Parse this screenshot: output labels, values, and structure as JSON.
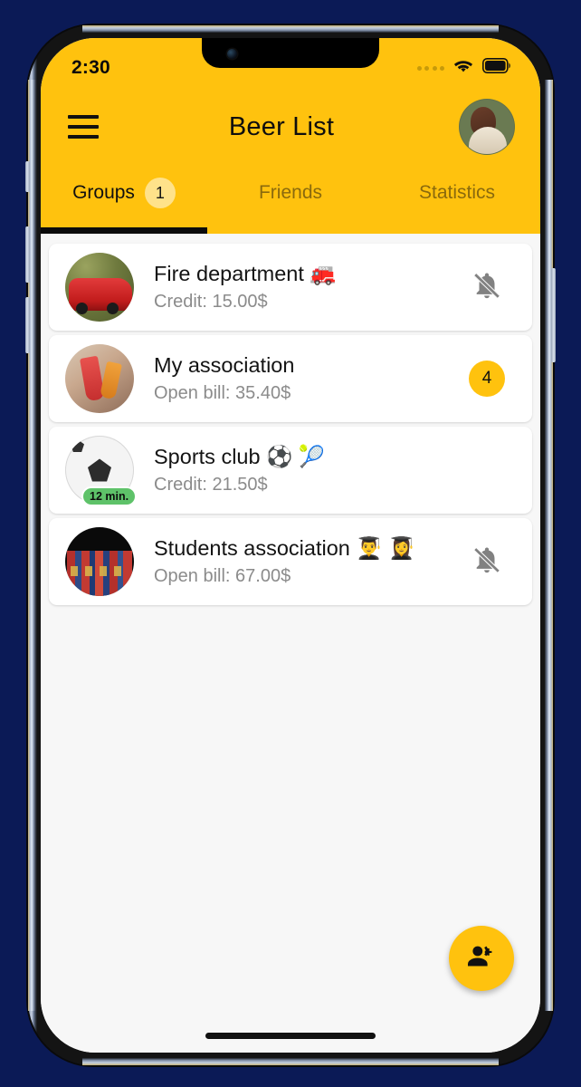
{
  "status_bar": {
    "time": "2:30",
    "signal_icon": "signal-dots-icon",
    "wifi_icon": "wifi-icon",
    "battery_icon": "battery-full-icon"
  },
  "app_bar": {
    "menu_icon": "hamburger-menu-icon",
    "title": "Beer List",
    "avatar_icon": "user-avatar"
  },
  "tabs": [
    {
      "label": "Groups",
      "badge": "1",
      "active": true
    },
    {
      "label": "Friends",
      "badge": "",
      "active": false
    },
    {
      "label": "Statistics",
      "badge": "",
      "active": false
    }
  ],
  "groups": [
    {
      "name": "Fire department 🚒",
      "subtitle": "Credit: 15.00$",
      "avatar_icon": "fire-truck-avatar",
      "avatar_class": "av-fire",
      "time_badge": "",
      "trailing_type": "bell-off",
      "trailing_value": ""
    },
    {
      "name": "My association",
      "subtitle": "Open bill: 35.40$",
      "avatar_icon": "drinks-cheers-avatar",
      "avatar_class": "av-drinks",
      "time_badge": "",
      "trailing_type": "count",
      "trailing_value": "4"
    },
    {
      "name": "Sports club ⚽ 🎾",
      "subtitle": "Credit: 21.50$",
      "avatar_icon": "soccer-ball-avatar",
      "avatar_class": "av-ball",
      "time_badge": "12 min.",
      "trailing_type": "none",
      "trailing_value": ""
    },
    {
      "name": "Students association 👨‍🎓 👩‍🎓",
      "subtitle": "Open bill: 67.00$",
      "avatar_icon": "books-avatar",
      "avatar_class": "av-books",
      "time_badge": "",
      "trailing_type": "bell-off",
      "trailing_value": ""
    }
  ],
  "fab": {
    "icon": "person-add-icon",
    "label": ""
  },
  "colors": {
    "brand_yellow": "#FFC20E",
    "badge_light_yellow": "#FFE28A",
    "time_badge_green": "#5EC269",
    "card_white": "#FFFFFF",
    "content_bg": "#F7F7F7",
    "page_bg": "#0B1A56",
    "muted_text": "#8B8B8B",
    "primary_text": "#141414"
  }
}
